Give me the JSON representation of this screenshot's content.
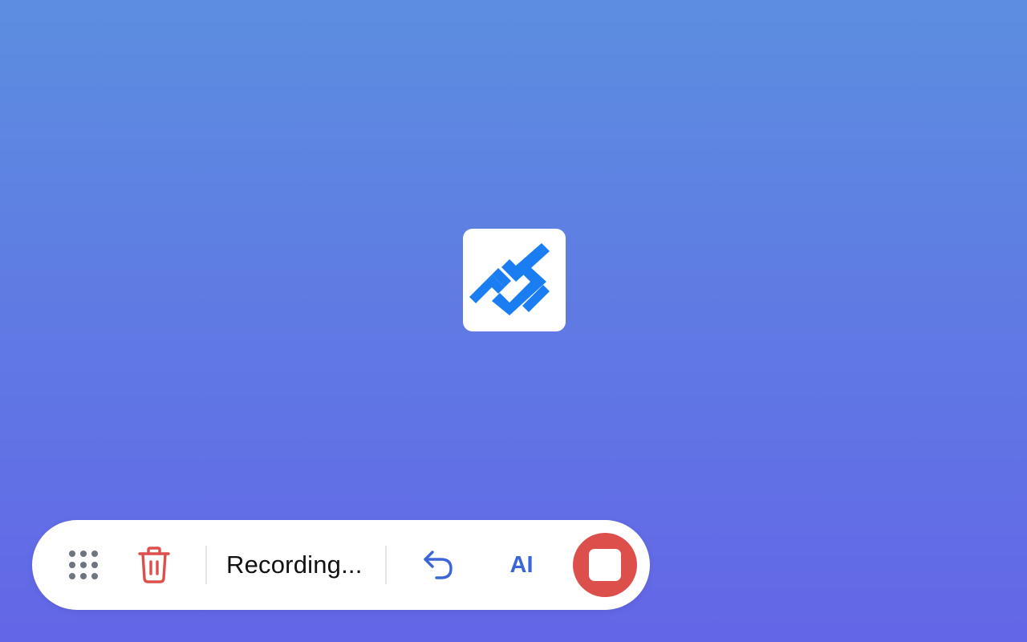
{
  "app": {
    "icon": "checkmarks-logo-icon"
  },
  "toolbar": {
    "grip_icon": "grip-dots-icon",
    "delete_icon": "trash-icon",
    "status_text": "Recording...",
    "undo_icon": "undo-arrow-icon",
    "ai_label": "AI",
    "stop_icon": "stop-square-icon"
  },
  "colors": {
    "background_top": "#5c8ee0",
    "background_bottom": "#6366e7",
    "logo_blue": "#1a7df2",
    "trash_red": "#dd4f4b",
    "accent_blue": "#3c66d8",
    "stop_red": "#dd4f4b"
  }
}
